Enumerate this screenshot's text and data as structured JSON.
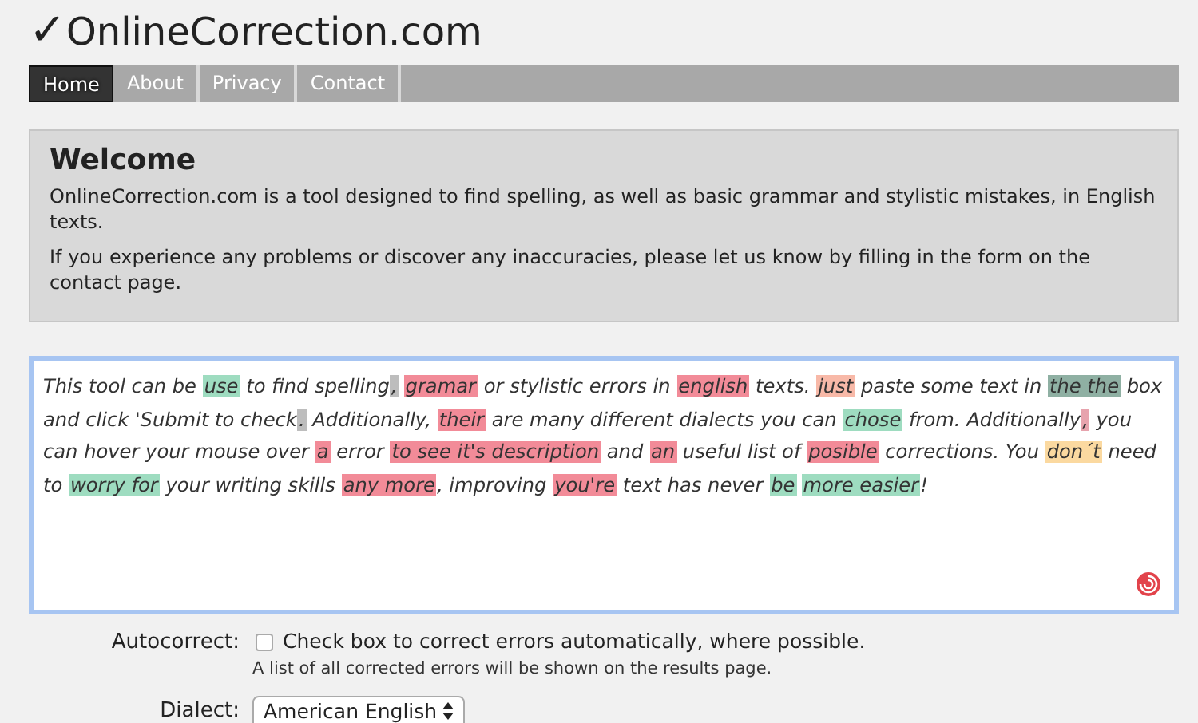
{
  "logo": {
    "mark": "✓",
    "text": "OnlineCorrection.com"
  },
  "nav": [
    {
      "label": "Home",
      "selected": true
    },
    {
      "label": "About",
      "selected": false
    },
    {
      "label": "Privacy",
      "selected": false
    },
    {
      "label": "Contact",
      "selected": false
    }
  ],
  "welcome": {
    "title": "Welcome",
    "paragraphs": [
      "OnlineCorrection.com is a tool designed to find spelling, as well as basic grammar and stylistic mistakes, in English texts.",
      "If you experience any problems or discover any inaccuracies, please let us know by filling in the form on the contact page."
    ]
  },
  "editor": {
    "segments": [
      {
        "text": "This tool can be "
      },
      {
        "text": "use",
        "color": "#9edcc0"
      },
      {
        "text": " to find spelling"
      },
      {
        "text": ",",
        "color": "#bdbdbd",
        "space_after": true
      },
      {
        "text": "gramar",
        "color": "#f28b98"
      },
      {
        "text": " or stylistic errors in "
      },
      {
        "text": "english",
        "color": "#f28b98"
      },
      {
        "text": " texts. "
      },
      {
        "text": "just",
        "color": "#f8b9a8"
      },
      {
        "text": " paste some text in "
      },
      {
        "text": "the the",
        "color": "#8fb0a3"
      },
      {
        "text": " box and click 'Submit to check"
      },
      {
        "text": ".",
        "color": "#bdbdbd"
      },
      {
        "text": " Additionally, "
      },
      {
        "text": "their",
        "color": "#f28b98"
      },
      {
        "text": " are many different dialects you can "
      },
      {
        "text": "chose",
        "color": "#9edcc0"
      },
      {
        "text": " from. Additionally"
      },
      {
        "text": ",",
        "color": "#e7a3ad"
      },
      {
        "text": " you can hover your mouse over "
      },
      {
        "text": "a",
        "color": "#f28b98"
      },
      {
        "text": " error "
      },
      {
        "text": "to see it's description",
        "color": "#f28b98"
      },
      {
        "text": " and "
      },
      {
        "text": "an",
        "color": "#f28b98"
      },
      {
        "text": " useful list of "
      },
      {
        "text": "posible",
        "color": "#f28b98"
      },
      {
        "text": " corrections. You "
      },
      {
        "text": "don´t",
        "color": "#fbd9a0"
      },
      {
        "text": " need to "
      },
      {
        "text": "worry for",
        "color": "#9edcc0"
      },
      {
        "text": " your writing skills "
      },
      {
        "text": "any more",
        "color": "#f28b98"
      },
      {
        "text": ", improving "
      },
      {
        "text": "you're",
        "color": "#f28b98"
      },
      {
        "text": " text has never "
      },
      {
        "text": "be",
        "color": "#9edcc0",
        "space_after": true
      },
      {
        "text": "more easier",
        "color": "#9edcc0"
      },
      {
        "text": "!"
      }
    ]
  },
  "autocorrect": {
    "label": "Autocorrect:",
    "checked": false,
    "text": "Check box to correct errors automatically, where possible.",
    "note": "A list of all corrected errors will be shown on the results page."
  },
  "dialect": {
    "label": "Dialect:",
    "value": "American English"
  }
}
